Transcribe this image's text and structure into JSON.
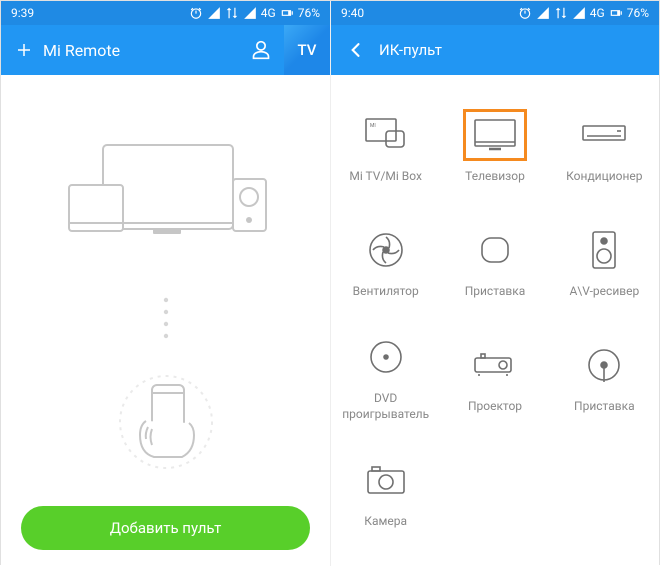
{
  "left": {
    "statusbar_time": "9:39",
    "battery_pct": "76%",
    "network": "4G",
    "header_title": "Mi Remote",
    "tab_tv": "TV",
    "add_button": "Добавить пульт"
  },
  "right": {
    "statusbar_time": "9:40",
    "battery_pct": "76%",
    "network": "4G",
    "header_title": "ИК-пульт",
    "devices": {
      "mitv": "Mi TV/Mi Box",
      "tv": "Телевизор",
      "ac": "Кондиционер",
      "fan": "Вентилятор",
      "settop": "Приставка",
      "av": "A\\V-ресивер",
      "dvd": "DVD проигрыватель",
      "projector": "Проектор",
      "settop2": "Приставка",
      "camera": "Камера"
    }
  }
}
